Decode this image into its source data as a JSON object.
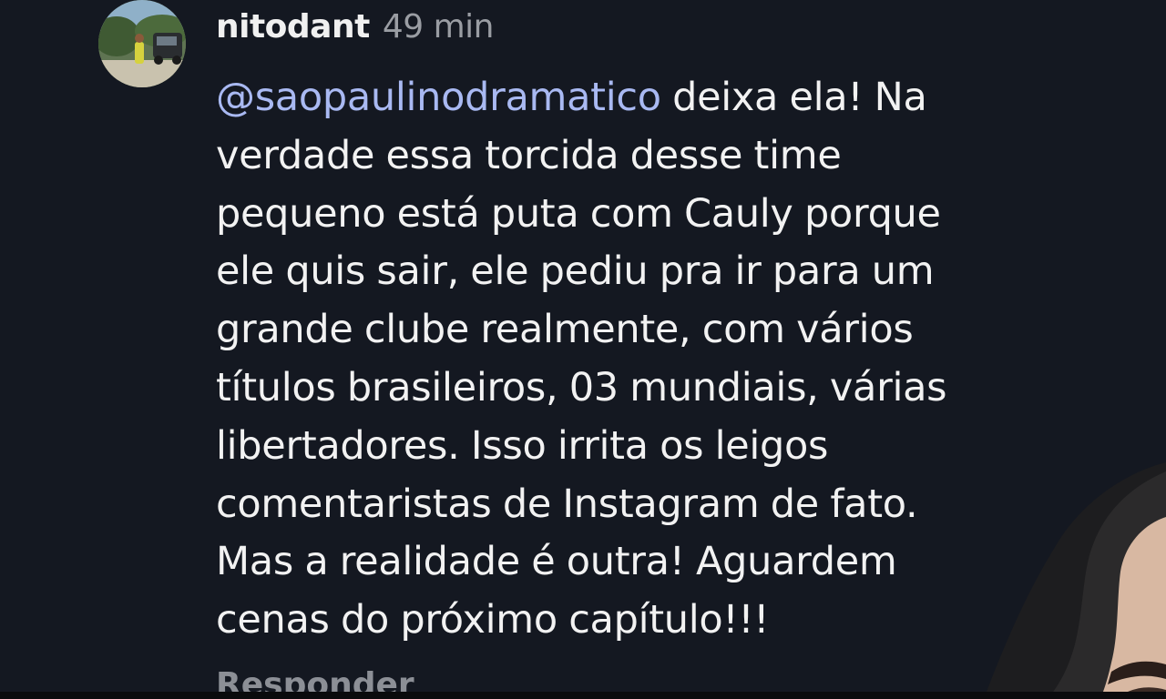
{
  "comment": {
    "username": "nitodant",
    "time": "49 min",
    "mention": "@saopaulinodramatico",
    "lines": [
      " deixa ela! Na",
      "verdade essa torcida desse time",
      "pequeno está puta com Cauly porque",
      "ele quis sair, ele pediu pra ir para um",
      "grande clube realmente, com vários",
      "títulos brasileiros, 03 mundiais, várias",
      "libertadores. Isso irrita os leigos",
      "comentaristas de Instagram de fato.",
      "Mas a realidade é outra! Aguardem",
      "cenas do próximo capítulo!!!"
    ],
    "reply_label": "Responder"
  },
  "colors": {
    "background": "#141821",
    "mention": "#a9b9f2",
    "text": "#f2f2f2",
    "muted": "#9a9da3"
  },
  "icons": {
    "avatar": "profile-photo",
    "overlay": "face-overlay"
  }
}
